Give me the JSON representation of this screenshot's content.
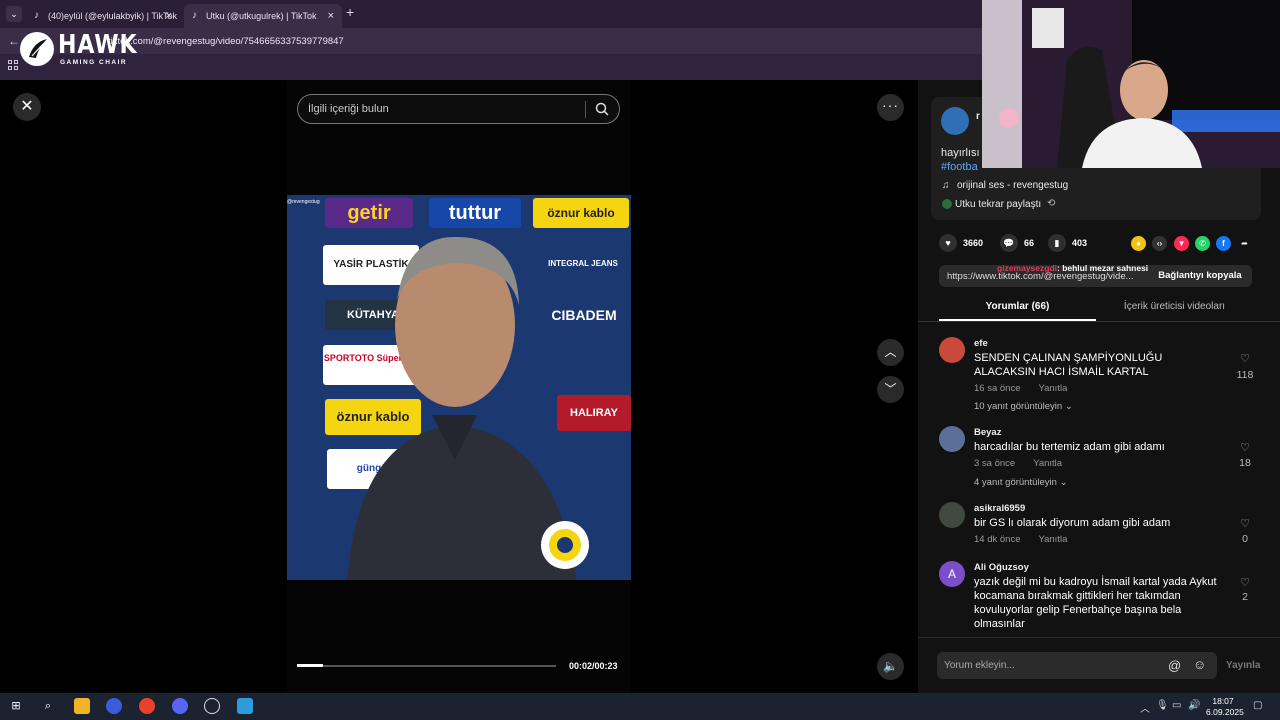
{
  "browser": {
    "tabs": [
      {
        "title": "(40)eylül (@eylulakbyik) | TikTok",
        "active": false
      },
      {
        "title": "Utku (@utkugulrek) | TikTok",
        "active": true
      }
    ],
    "close_glyph": "×",
    "new_tab_glyph": "+",
    "url": "tiktok.com/@revengestug/video/7546656337539779847"
  },
  "overlay_logo": {
    "brand": "HAWK",
    "subtitle": "GAMING CHAIR"
  },
  "search": {
    "placeholder": "İlgili içeriği bulun"
  },
  "video": {
    "time": "00:02/00:23",
    "progress": 0.1,
    "watermark": "@revengestug",
    "sponsors": [
      "getir",
      "tuttur",
      "öznur kablo",
      "YASİR PLASTİK",
      "INTEGRAL JEANS",
      "KÜTAHYA",
      "CIBADEM",
      "SPORTOTO Süper Lig",
      "öznur kablo",
      "HALIRAY",
      "güngör"
    ]
  },
  "post": {
    "author_initial": "r",
    "caption_start": "hayırlısı",
    "hashtag_start": "#footba",
    "music": "orijinal ses - revengestug",
    "repost": "Utku tekrar paylaştı"
  },
  "stats": {
    "likes": "3660",
    "comments": "66",
    "saves": "403"
  },
  "link": {
    "url": "https://www.tiktok.com/@revengestug/vide...",
    "copy_label": "Bağlantıyı kopyala"
  },
  "overlay_chat": {
    "user": "gizemaysezgdi",
    "message": ": behlul mezar sahnesi"
  },
  "tabs": {
    "comments": "Yorumlar (66)",
    "creator": "İçerik üreticisi videoları"
  },
  "comments": [
    {
      "user": "efe",
      "text": "SENDEN ÇALINAN ŞAMPİYONLUĞU ALACAKSIN HACI İSMAİL KARTAL",
      "time": "16 sa önce",
      "reply": "Yanıtla",
      "likes": "118",
      "replies": "10 yanıt görüntüleyin",
      "avatar_color": "#c94a3b"
    },
    {
      "user": "Beyaz",
      "text": "harcadılar bu tertemiz adam gibi adamı",
      "time": "3 sa önce",
      "reply": "Yanıtla",
      "likes": "18",
      "replies": "4 yanıt görüntüleyin",
      "avatar_color": "#5a6f9a"
    },
    {
      "user": "asikral6959",
      "text": "bir GS lı olarak diyorum adam gibi adam",
      "time": "14 dk önce",
      "reply": "Yanıtla",
      "likes": "0",
      "replies": "",
      "avatar_color": "#3e4a3e"
    },
    {
      "user": "Ali Oğuzsoy",
      "text": "yazık değil mi bu kadroyu İsmail kartal yada Aykut kocamana bırakmak gittikleri her takımdan kovuluyorlar gelip Fenerbahçe başına bela olmasınlar",
      "time": "",
      "reply": "",
      "likes": "2",
      "replies": "",
      "avatar_color": "#7b4fc9",
      "avatar_letter": "A"
    }
  ],
  "comment_input": {
    "placeholder": "Yorum ekleyin...",
    "post_label": "Yayınla"
  },
  "taskbar": {
    "time": "18:07",
    "date": "6.09.2025"
  },
  "colors": {
    "accent": "#fe2c55",
    "panel": "#121212"
  }
}
